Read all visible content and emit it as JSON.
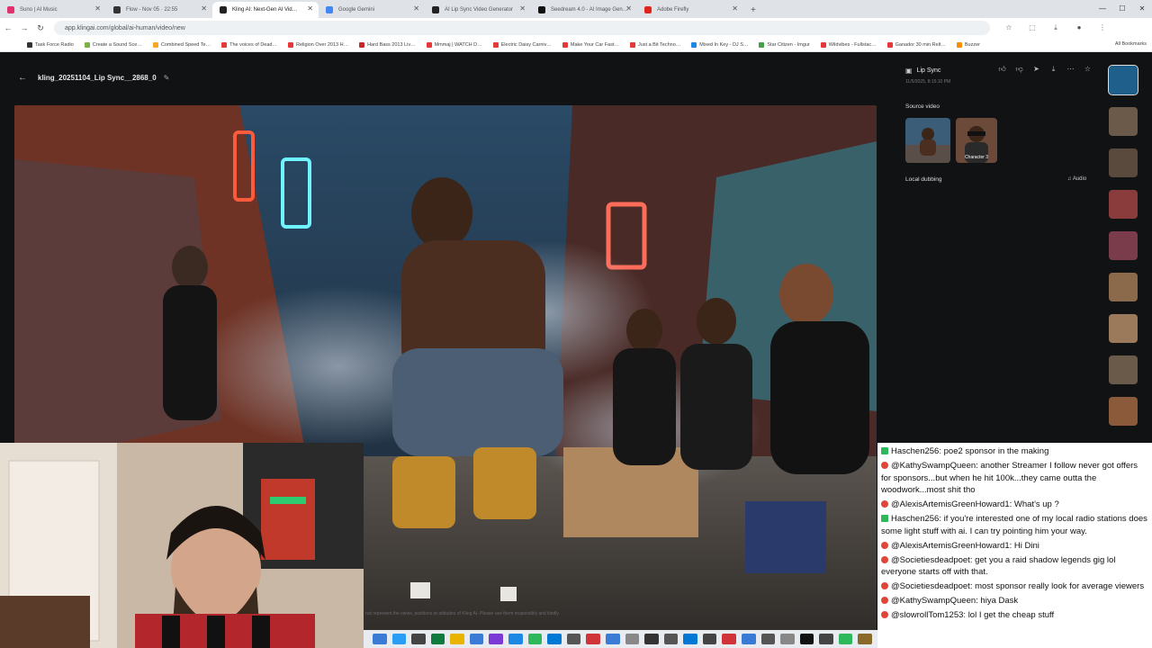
{
  "browser": {
    "tabs": [
      {
        "label": "Suno | AI Music",
        "color": "#e1306c"
      },
      {
        "label": "Flow - Nov 05 · 22:55",
        "color": "#333333"
      },
      {
        "label": "Kling AI: Next-Gen AI Vid…",
        "color": "#222222"
      },
      {
        "label": "Google Gemini",
        "color": "#4285f4"
      },
      {
        "label": "AI Lip Sync Video Generator",
        "color": "#222222"
      },
      {
        "label": "Seedream 4.0 - AI Image Gen…",
        "color": "#111111"
      },
      {
        "label": "Adobe Firefly",
        "color": "#e1251b"
      }
    ],
    "new_tab": "+",
    "url": "app.klingai.com/global/ai-human/video/new",
    "bookmarks": [
      {
        "label": "Task Force Radio",
        "color": "#333"
      },
      {
        "label": "Create a Sound Sce…",
        "color": "#7cb342"
      },
      {
        "label": "Combined Speed Te…",
        "color": "#f9a825"
      },
      {
        "label": "The voices of Dead…",
        "color": "#e53935"
      },
      {
        "label": "Religion Over 2013 H…",
        "color": "#e53935"
      },
      {
        "label": "Hard Bass 2013 Liv…",
        "color": "#c62828"
      },
      {
        "label": "Mmmaj | WATCH D…",
        "color": "#e53935"
      },
      {
        "label": "Electric Daisy Carniv…",
        "color": "#e53935"
      },
      {
        "label": "Make Your Car Fast…",
        "color": "#e53935"
      },
      {
        "label": "Just a Bit Techno…",
        "color": "#e53935"
      },
      {
        "label": "Mixed In Key - DJ S…",
        "color": "#1e88e5"
      },
      {
        "label": "Star Citizen - Imgur",
        "color": "#43a047"
      },
      {
        "label": "Wildvibes - Fullstac…",
        "color": "#e53935"
      },
      {
        "label": "Ganador 30 min Relt…",
        "color": "#e53935"
      },
      {
        "label": "Buzzer",
        "color": "#fb8c00"
      }
    ],
    "bookmarks_right": "All Bookmarks"
  },
  "kling": {
    "file_title": "kling_20251104_Lip Sync__2868_0",
    "disclaimer": "not represent the views, positions or attitudes of Kling AI. Please use them responsibly and kindly.",
    "panel": {
      "title": "Lip Sync",
      "date": "11/5/2025, 8:15:10 PM",
      "source_video_label": "Source video",
      "character_label": "Character 3",
      "local_dubbing_label": "Local dubbing",
      "audio_label": "Audio"
    },
    "history_count": 9
  },
  "chat": [
    {
      "user": "Haschen256",
      "text": "poe2 sponsor in the making",
      "badge": "green"
    },
    {
      "user": "@KathySwampQueen",
      "text": "another Streamer I follow never got offers for sponsors...but when he hit 100k...they came outta the woodwork...most shit tho",
      "badge": "red"
    },
    {
      "user": "@AlexisArtemisGreenHoward1",
      "text": "What's up ?",
      "badge": "red"
    },
    {
      "user": "Haschen256",
      "text": "if you're interested one of my local radio stations does some light stuff with ai. I can try pointing him your way.",
      "badge": "green"
    },
    {
      "user": "@AlexisArtemisGreenHoward1",
      "text": "Hi Dini",
      "badge": "red"
    },
    {
      "user": "@Societiesdeadpoet",
      "text": "get you a raid shadow legends gig lol everyone starts off with that.",
      "badge": "red"
    },
    {
      "user": "@Societiesdeadpoet",
      "text": "most sponsor really look for average viewers",
      "badge": "red"
    },
    {
      "user": "@KathySwampQueen",
      "text": "hiya Dask",
      "badge": "red"
    },
    {
      "user": "@slowrollTom1253",
      "text": "lol I get the cheap stuff",
      "badge": "red"
    }
  ]
}
